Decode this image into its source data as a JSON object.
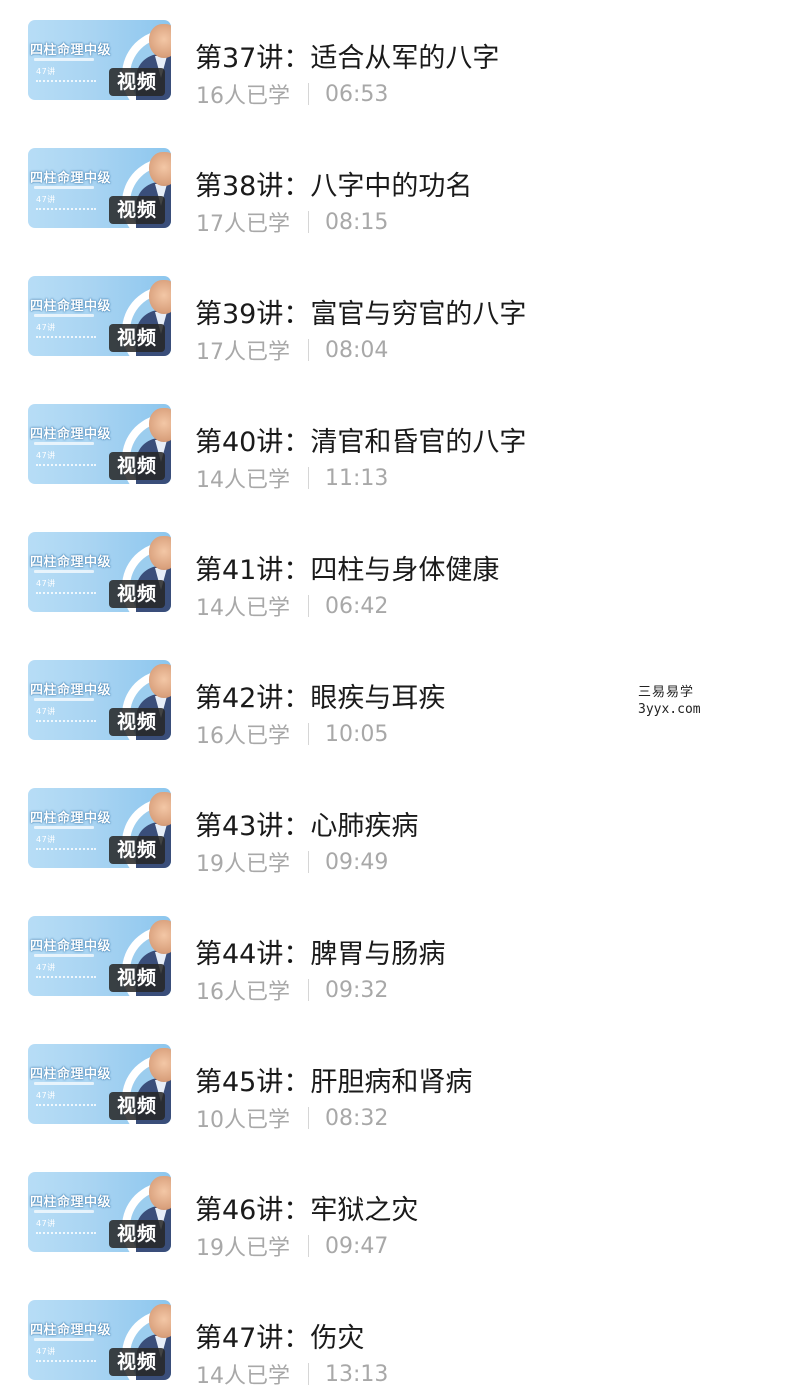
{
  "lessons": [
    {
      "title": "第37讲：适合从军的八字",
      "learners": "16人已学",
      "duration": "06:53"
    },
    {
      "title": "第38讲：八字中的功名",
      "learners": "17人已学",
      "duration": "08:15"
    },
    {
      "title": "第39讲：富官与穷官的八字",
      "learners": "17人已学",
      "duration": "08:04"
    },
    {
      "title": "第40讲：清官和昏官的八字",
      "learners": "14人已学",
      "duration": "11:13"
    },
    {
      "title": "第41讲：四柱与身体健康",
      "learners": "14人已学",
      "duration": "06:42"
    },
    {
      "title": "第42讲：眼疾与耳疾",
      "learners": "16人已学",
      "duration": "10:05"
    },
    {
      "title": "第43讲：心肺疾病",
      "learners": "19人已学",
      "duration": "09:49"
    },
    {
      "title": "第44讲：脾胃与肠病",
      "learners": "16人已学",
      "duration": "09:32"
    },
    {
      "title": "第45讲：肝胆病和肾病",
      "learners": "10人已学",
      "duration": "08:32"
    },
    {
      "title": "第46讲：牢狱之灾",
      "learners": "19人已学",
      "duration": "09:47"
    },
    {
      "title": "第47讲：伤灾",
      "learners": "14人已学",
      "duration": "13:13"
    }
  ],
  "thumbnail": {
    "course_title": "四柱命理中级",
    "lesson_count": "47讲",
    "badge": "视频"
  },
  "watermark": {
    "line1": "三易易学",
    "line2": "3yyx.com"
  },
  "colors": {
    "title": "#1a1a1a",
    "meta": "#a8a8a8",
    "thumb_bg": "#a9d4f2",
    "badge_bg": "#262626"
  }
}
